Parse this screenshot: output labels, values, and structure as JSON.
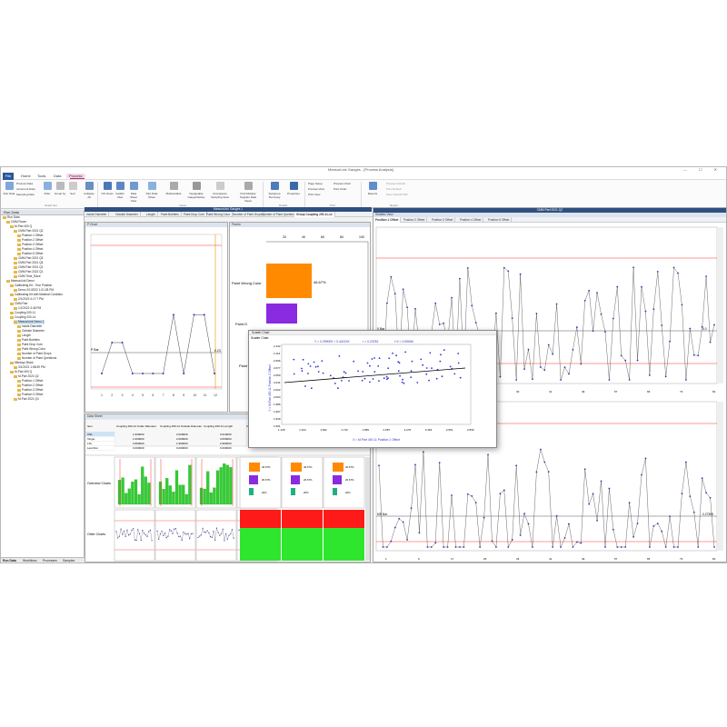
{
  "app": {
    "title": "MeasurLink Gauges - [Process Analysis]",
    "menus": [
      "File",
      "Home",
      "Tools",
      "Data",
      "Workflow"
    ],
    "context_label": "Process"
  },
  "ribbon": {
    "buttons": [
      "Run Data",
      "Increment Data",
      "Filter",
      "Group by",
      "Sort",
      "Collapse All",
      "CD Views",
      "Cadder View",
      "Data Sheet View",
      "Part Data Sheet",
      "Multivariable",
      "Designable Gauge/Variety",
      "Acceptance Sampling View",
      "Find Multiple Supplier Data Views",
      "Subgroup Summary",
      "Properties",
      "Reports"
    ],
    "small_items": [
      "Process Data",
      "Increment Data",
      "Sampling Data",
      "Page Setup",
      "Preview View",
      "Print View",
      "Preview Chart",
      "Print Chart",
      "Preview Default",
      "Print Default",
      "Save Default PDF"
    ],
    "groups": [
      "Graph Set",
      "Views",
      "Details",
      "Print",
      "Report"
    ]
  },
  "run_data": {
    "title": "Run Data",
    "tree": [
      "Run Data",
      "CMM Room",
      "M-Part 400 Q",
      "CMM Part 2021 Q2",
      "Position 1 Offset",
      "Position 2 Offset",
      "Position 3 Offset",
      "Position 4 Offset",
      "Position 5 Offset",
      "CMM Part 2021 Q3",
      "CMM Part 2021 Q4",
      "CMM Part 2021 Q1",
      "CMM Part 2022 Q1",
      "CMM Time_Race",
      "MeasurLink Demo",
      "Calibrating Kit - True Position",
      "Demo 2/1/2022 1:01:28 PM",
      "Calibrating Kit with Material Condition",
      "2/1/2022 4:17:7 PM",
      "CMM Part",
      "1/1/2022 4:46 PM",
      "Coupling 200-11",
      "Coupling 200-14",
      "MeasurLink Demo 1",
      "Inside Diameter",
      "Outside Diameter",
      "Length",
      "Paint Bubbles",
      "Paint Drop Cure",
      "Paint Wrong Color",
      "Number of Paint Drops",
      "Number of Paint Questions",
      "Mitutoyo Block",
      "3/1/2021 1:58:39 PM",
      "M-Part 400 Q",
      "M-Part 2021 Q2",
      "Position 1 Offset",
      "Position 2 Offset",
      "Position 3 Offset",
      "Position 4 Offset",
      "M-Part 2021 Q4"
    ],
    "tabs": [
      "Run Data",
      "Workflows",
      "Processes",
      "Samples"
    ]
  },
  "chart_windows": {
    "title": "MeasurLink Gauges 1",
    "tabs": [
      "Inside Diameter",
      "Outside Diameter",
      "Length",
      "Paint Bubbles",
      "Paint Drop Cure",
      "Paint Wrong Color",
      "Number of Paint Drops",
      "Number of Paint Questions",
      "Group Coupling 200-11-14"
    ],
    "right_tab": "CMM"
  },
  "right_window": {
    "title": "CMM Part 2021 Q2",
    "tabs": [
      "Position 1 Offset",
      "Position 2 Offset",
      "Position 3 Offset",
      "Position 4 Offset",
      "Position 5 Offset"
    ],
    "subtitle": "Statistic View"
  },
  "p_chart": {
    "title": "P Chart",
    "ylabel": "P Bar",
    "center_value": "0.23",
    "x": [
      1,
      2,
      3,
      4,
      5,
      6,
      7,
      8,
      9,
      10,
      11,
      12
    ],
    "values": [
      0.1,
      0.3,
      0.3,
      0.1,
      0.1,
      0.1,
      0.1,
      0.48,
      0.1,
      0.48,
      0.48,
      0.1
    ],
    "ylim": [
      0,
      1
    ]
  },
  "pareto": {
    "title": "Pareto",
    "ticks": [
      "20",
      "40",
      "60",
      "80",
      "100"
    ],
    "labels": [
      "Paint Wrong Color",
      "Paint D",
      "Paint"
    ],
    "value_label": "46.67%",
    "colors": [
      "#ff8a00",
      "#8a2be2"
    ]
  },
  "scatter": {
    "window_title": "Scatter Chart",
    "chart_title": "Scatter Chart",
    "equation": "Y = 0.299009 + 0.44219X",
    "r_value": "r = 0.23783",
    "r2_value": "r^2 = 0.05656",
    "xlabel": "X = M-Part 400 11 Position 1 Offset",
    "ylabel": "Y = M-Part 400 11 Position 2 Offset",
    "xticks": [
      "1.145",
      "1.334",
      "1.522",
      "1.710",
      "1.899",
      "2.087",
      "2.276",
      "2.463",
      "2.651",
      "2.839"
    ],
    "yticks": [
      "2.132",
      "2.114",
      "2.096",
      "2.077",
      "2.059",
      "2.041",
      "2.022",
      "2.004",
      "1.986",
      "1.967",
      "1.949",
      "1.931"
    ]
  },
  "data_sheet": {
    "title": "Data Sheet",
    "header": [
      "Item",
      "Coupling 200-14 Inside Diameter",
      "Coupling 200-14 Outside Diameter",
      "Coupling 200-14 Length",
      "Crou"
    ],
    "rows": [
      [
        "USL",
        "1.000000",
        "2.000000",
        "3.010000",
        ""
      ],
      [
        "Target",
        "1.000000",
        "2.000000",
        "3.000000",
        ""
      ],
      [
        "LSL",
        "0.990000",
        "1.990000",
        "2.990000",
        ""
      ],
      [
        "Last Run",
        "0.000000",
        "0.000000",
        "0.000000",
        ""
      ]
    ],
    "overview_label": "Overview Charts",
    "other_label": "Other Charts",
    "pct": [
      "46.67%",
      "26.67%",
      "20%"
    ]
  },
  "xbar_chart": {
    "ylabel": "X Bar",
    "value": "5.0"
  },
  "mr_chart": {
    "ylabel": "MR Bar",
    "value": "0.27389"
  },
  "colors": {
    "accent": "#2b579a",
    "limit": "#ff3333",
    "line": "#333333",
    "point": "#3333cc"
  }
}
